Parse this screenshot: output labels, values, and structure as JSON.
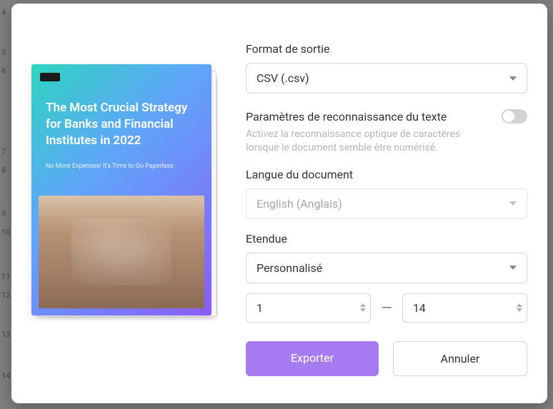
{
  "page_markers": [
    "4",
    "5",
    "6",
    "7",
    "8",
    "9",
    "10",
    "11",
    "12",
    "13",
    "14"
  ],
  "preview": {
    "cover_title_line1": "The Most Crucial Strategy",
    "cover_title_line2": "for Banks and Financial",
    "cover_title_line3": "Institutes in 2022",
    "cover_subtitle": "No More Expenses! It's Time to Go Paperless"
  },
  "format": {
    "label": "Format de sortie",
    "value": "CSV (.csv)"
  },
  "recognition": {
    "label": "Paramètres de reconnaissance du texte",
    "description": "Activez la reconnaissance optique de caractères lorsque le document semble être numérisé.",
    "enabled": false
  },
  "language": {
    "label": "Langue du document",
    "value": "English (Anglais)"
  },
  "range": {
    "label": "Etendue",
    "value": "Personnalisé",
    "from": "1",
    "to": "14",
    "sep": "—"
  },
  "actions": {
    "export": "Exporter",
    "cancel": "Annuler"
  }
}
